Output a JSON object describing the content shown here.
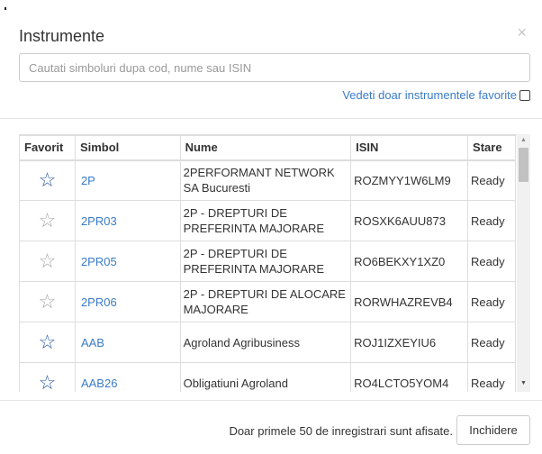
{
  "dialog": {
    "title": "Instrumente",
    "close_glyph": "×"
  },
  "search": {
    "value": "",
    "placeholder": "Cautati simboluri dupa cod, nume sau ISIN"
  },
  "favorites_filter": {
    "label": "Vedeti doar instrumentele favorite",
    "checked": false
  },
  "table": {
    "headers": {
      "favorite": "Favorit",
      "symbol": "Simbol",
      "name": "Nume",
      "isin": "ISIN",
      "state": "Stare"
    },
    "rows": [
      {
        "favorite": true,
        "symbol": "2P",
        "name": "2PERFORMANT NETWORK SA Bucuresti",
        "isin": "ROZMYY1W6LM9",
        "state": "Ready"
      },
      {
        "favorite": false,
        "symbol": "2PR03",
        "name": "2P - DREPTURI DE PREFERINTA MAJORARE",
        "isin": "ROSXK6AUU873",
        "state": "Ready"
      },
      {
        "favorite": false,
        "symbol": "2PR05",
        "name": "2P - DREPTURI DE PREFERINTA MAJORARE",
        "isin": "RO6BEKXY1XZ0",
        "state": "Ready"
      },
      {
        "favorite": false,
        "symbol": "2PR06",
        "name": "2P - DREPTURI DE ALOCARE MAJORARE",
        "isin": "RORWHAZREVB4",
        "state": "Ready"
      },
      {
        "favorite": true,
        "symbol": "AAB",
        "name": "Agroland Agribusiness",
        "isin": "ROJ1IZXEYIU6",
        "state": "Ready"
      },
      {
        "favorite": true,
        "symbol": "AAB26",
        "name": "Obligatiuni Agroland",
        "isin": "RO4LCTO5YOM4",
        "state": "Ready"
      }
    ]
  },
  "icons": {
    "star_glyph": "☆",
    "favorite_star_color": "#2b5aa3",
    "non_favorite_star_color": "#a7a7a7",
    "scroll_up": "▲",
    "scroll_down": "▼"
  },
  "colors": {
    "link": "#3a7bc8"
  },
  "footer": {
    "note": "Doar primele 50 de inregistrari sunt afisate.",
    "close_label": "Inchidere"
  }
}
